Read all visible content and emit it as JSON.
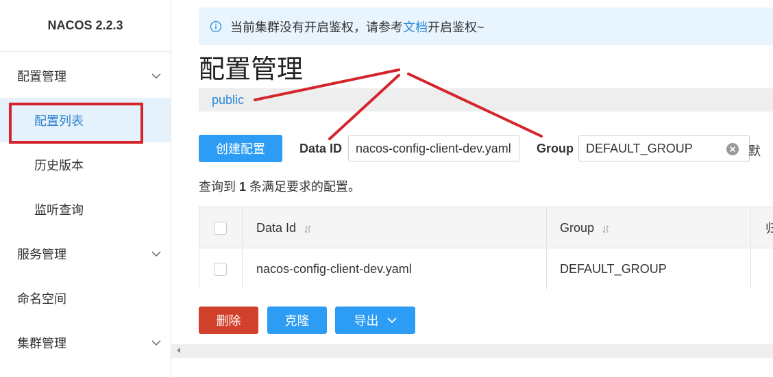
{
  "app": {
    "title": "NACOS 2.2.3"
  },
  "sidebar": {
    "groups": [
      {
        "label": "配置管理"
      },
      {
        "label": "服务管理"
      },
      {
        "label": "命名空间"
      },
      {
        "label": "集群管理"
      }
    ],
    "config_items": [
      {
        "label": "配置列表",
        "active": true
      },
      {
        "label": "历史版本"
      },
      {
        "label": "监听查询"
      }
    ]
  },
  "notice": {
    "prefix": "当前集群没有开启鉴权，请参考",
    "link": "文档",
    "suffix": "开启鉴权~"
  },
  "page": {
    "title": "配置管理",
    "namespace": "public"
  },
  "toolbar": {
    "create_label": "创建配置",
    "dataid_label": "Data ID",
    "dataid_value": "nacos-config-client-dev.yaml",
    "group_label": "Group",
    "group_value": "DEFAULT_GROUP",
    "cut_label": "默"
  },
  "result": {
    "prefix": "查询到",
    "count": "1",
    "suffix": "条满足要求的配置。"
  },
  "table": {
    "columns": [
      "Data Id",
      "Group",
      "归"
    ],
    "rows": [
      {
        "data_id": "nacos-config-client-dev.yaml",
        "group": "DEFAULT_GROUP"
      }
    ]
  },
  "actions": {
    "delete": "删除",
    "clone": "克隆",
    "export": "导出"
  },
  "colors": {
    "primary": "#2c9cf5",
    "danger": "#d1402a",
    "annotation": "#d4242c",
    "active_bg": "#e5f2fb"
  }
}
